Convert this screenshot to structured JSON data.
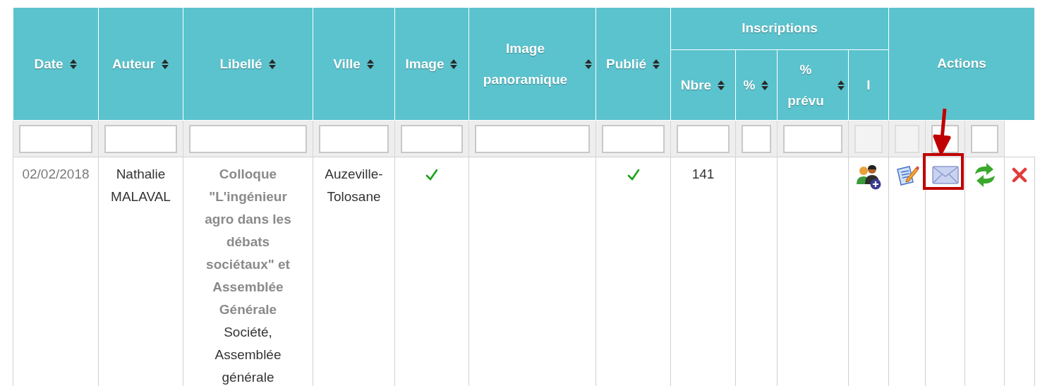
{
  "table": {
    "header": [
      {
        "label": "Date",
        "sortable": true
      },
      {
        "label": "Auteur",
        "sortable": true
      },
      {
        "label": "Libellé",
        "sortable": true
      },
      {
        "label": "Ville",
        "sortable": true
      },
      {
        "label": "Image",
        "sortable": true
      },
      {
        "label": "Image panoramique",
        "sortable": true
      },
      {
        "label": "Publié",
        "sortable": true
      },
      {
        "label": "Inscriptions",
        "children": [
          {
            "label": "Nbre",
            "sortable": true
          },
          {
            "label": "%",
            "sortable": true
          },
          {
            "label": "% prévu",
            "sortable": true
          },
          {
            "label": "I",
            "sortable": false
          }
        ]
      },
      {
        "label": "Actions",
        "actions_header": true
      }
    ],
    "filters": [
      {
        "disabled": false
      },
      {
        "disabled": false
      },
      {
        "disabled": false
      },
      {
        "disabled": false
      },
      {
        "disabled": false
      },
      {
        "disabled": false
      },
      {
        "disabled": false
      },
      {
        "disabled": false
      },
      {
        "disabled": false
      },
      {
        "disabled": false
      },
      {
        "disabled": true
      },
      {
        "disabled": true
      },
      {
        "disabled": false
      },
      {
        "disabled": false
      }
    ],
    "rows": [
      {
        "date": "02/02/2018",
        "author": "Nathalie MALAVAL",
        "title": "Colloque \"L'ingénieur agro dans les débats sociétaux\" et Assemblée Générale",
        "tags": "Société, Assemblée générale",
        "city": "Auzeville-Tolosane",
        "image": true,
        "panoramic": false,
        "published": true,
        "count": "141",
        "actions": [
          {
            "kind": "edit",
            "highlighted": false
          },
          {
            "kind": "mail",
            "highlighted": true
          },
          {
            "kind": "refresh",
            "highlighted": false
          },
          {
            "kind": "delete",
            "highlighted": false
          }
        ]
      }
    ]
  }
}
